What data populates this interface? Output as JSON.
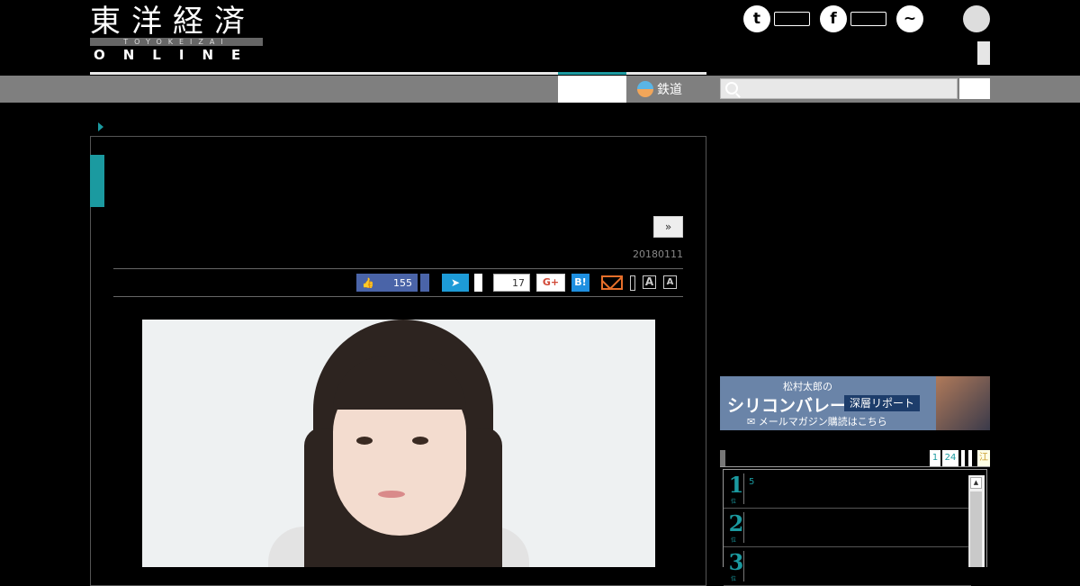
{
  "header": {
    "logo_kanji": "東洋経済",
    "logo_romaji": "TOYOKEIZAI",
    "logo_online": "ONLINE",
    "twitter_glyph": "t",
    "facebook_glyph": "f",
    "messenger_glyph": "~",
    "icons": [
      "twitter-icon",
      "facebook-icon",
      "messenger-icon",
      "rss-icon"
    ]
  },
  "nav": {
    "rail_label": "鉄道",
    "accent_color": "#1b9aa0"
  },
  "article": {
    "next_label": "»",
    "date": "20180111",
    "share": {
      "like_count": "155",
      "tweet_count": "17",
      "gplus_label": "G+",
      "hatena_label": "B!",
      "font_large": "A",
      "font_small": "A"
    }
  },
  "sidebar": {
    "banner": {
      "subtitle": "松村太郎の",
      "title": "シリコンバレー",
      "chip": "深層リポート",
      "mail": "メールマガジン購読はこちら"
    },
    "ranking": {
      "tabs": [
        "1",
        "24",
        "",
        "",
        "江"
      ],
      "items": [
        {
          "rank": "1",
          "sub": "位",
          "text": "5"
        },
        {
          "rank": "2",
          "sub": "位",
          "text": ""
        },
        {
          "rank": "3",
          "sub": "位",
          "text": ""
        }
      ],
      "scroll_up": "▲"
    }
  }
}
